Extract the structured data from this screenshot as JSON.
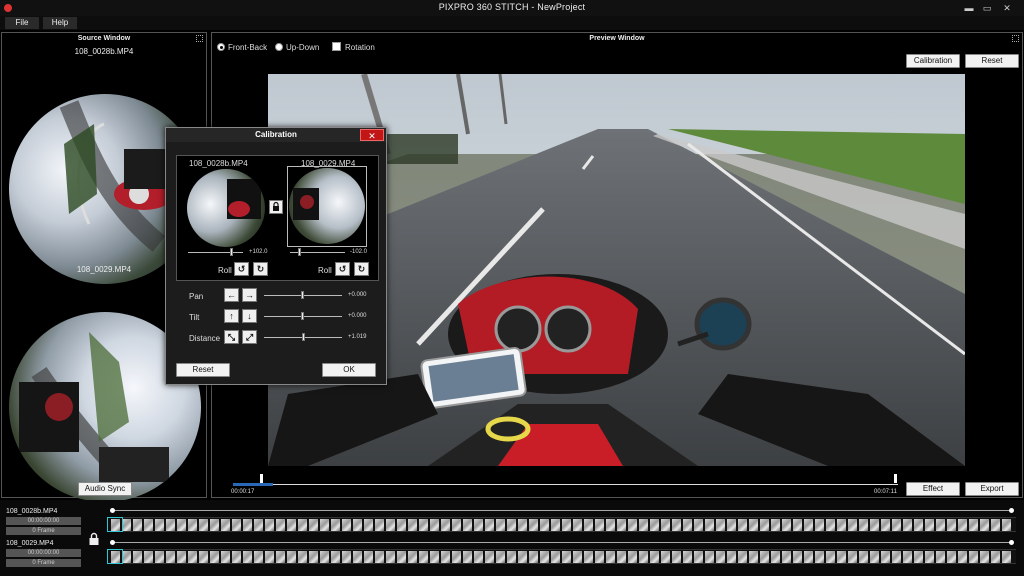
{
  "window": {
    "title": "PIXPRO 360 STITCH - NewProject",
    "minimize": "▬",
    "maximize": "▭",
    "close": "✕"
  },
  "menu": {
    "file": "File",
    "help": "Help"
  },
  "source": {
    "title": "Source Window",
    "file1": "108_0028b.MP4",
    "file2": "108_0029.MP4",
    "audio_sync": "Audio Sync"
  },
  "preview": {
    "title": "Preview Window",
    "option_front_back": "Front-Back",
    "option_up_down": "Up-Down",
    "option_rotation": "Rotation",
    "calibration": "Calibration",
    "reset": "Reset",
    "effect": "Effect",
    "export": "Export",
    "time_start": "00:00:17",
    "time_end": "00:07:11",
    "progress": 0.06
  },
  "calibration_dialog": {
    "title": "Calibration",
    "close": "✕",
    "file1": "108_0028b.MP4",
    "file2": "108_0029.MP4",
    "value1": "+102.0",
    "value2": "-102.0",
    "roll": "Roll",
    "pan": "Pan",
    "tilt": "Tilt",
    "distance": "Distance",
    "pan_value": "+0.000",
    "tilt_value": "+0.000",
    "distance_value": "+1.019",
    "reset": "Reset",
    "ok": "OK",
    "arrows": {
      "left": "←",
      "right": "→",
      "up": "↑",
      "down": "↓",
      "shrink": "⤡",
      "expand": "⤢",
      "rotate_left": "↺",
      "rotate_right": "↻"
    }
  },
  "timeline": {
    "track1": {
      "file": "108_0028b.MP4",
      "time": "00:00:00:00",
      "frame": "0 Frame"
    },
    "track2": {
      "file": "108_0029.MP4",
      "time": "00:00:00:00",
      "frame": "0 Frame"
    }
  },
  "colors": {
    "accent": "#31c6d1",
    "close_red": "#c21515"
  }
}
